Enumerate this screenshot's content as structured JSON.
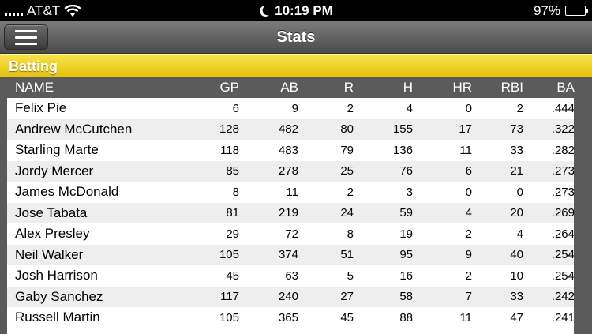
{
  "status_bar": {
    "carrier": "AT&T",
    "time": "10:19 PM",
    "battery": "97%",
    "battery_level": 0.97,
    "icons": [
      "signal-icon",
      "wifi-icon",
      "moon-icon",
      "battery-icon"
    ]
  },
  "nav": {
    "title": "Stats",
    "menu_icon": "hamburger-icon"
  },
  "section": {
    "title": "Batting"
  },
  "columns": [
    "NAME",
    "GP",
    "AB",
    "R",
    "H",
    "HR",
    "RBI",
    "BA"
  ],
  "rows": [
    {
      "name": "Felix Pie",
      "gp": "6",
      "ab": "9",
      "r": "2",
      "h": "4",
      "hr": "0",
      "rbi": "2",
      "ba": ".444"
    },
    {
      "name": "Andrew McCutchen",
      "gp": "128",
      "ab": "482",
      "r": "80",
      "h": "155",
      "hr": "17",
      "rbi": "73",
      "ba": ".322"
    },
    {
      "name": "Starling Marte",
      "gp": "118",
      "ab": "483",
      "r": "79",
      "h": "136",
      "hr": "11",
      "rbi": "33",
      "ba": ".282"
    },
    {
      "name": "Jordy Mercer",
      "gp": "85",
      "ab": "278",
      "r": "25",
      "h": "76",
      "hr": "6",
      "rbi": "21",
      "ba": ".273"
    },
    {
      "name": "James McDonald",
      "gp": "8",
      "ab": "11",
      "r": "2",
      "h": "3",
      "hr": "0",
      "rbi": "0",
      "ba": ".273"
    },
    {
      "name": "Jose Tabata",
      "gp": "81",
      "ab": "219",
      "r": "24",
      "h": "59",
      "hr": "4",
      "rbi": "20",
      "ba": ".269"
    },
    {
      "name": "Alex Presley",
      "gp": "29",
      "ab": "72",
      "r": "8",
      "h": "19",
      "hr": "2",
      "rbi": "4",
      "ba": ".264"
    },
    {
      "name": "Neil Walker",
      "gp": "105",
      "ab": "374",
      "r": "51",
      "h": "95",
      "hr": "9",
      "rbi": "40",
      "ba": ".254"
    },
    {
      "name": "Josh Harrison",
      "gp": "45",
      "ab": "63",
      "r": "5",
      "h": "16",
      "hr": "2",
      "rbi": "10",
      "ba": ".254"
    },
    {
      "name": "Gaby Sanchez",
      "gp": "117",
      "ab": "240",
      "r": "27",
      "h": "58",
      "hr": "7",
      "rbi": "33",
      "ba": ".242"
    },
    {
      "name": "Russell Martin",
      "gp": "105",
      "ab": "365",
      "r": "45",
      "h": "88",
      "hr": "11",
      "rbi": "47",
      "ba": ".241"
    }
  ],
  "colors": {
    "section_yellow": "#f2d41c",
    "nav_gray": "#5b5b5b",
    "row_alt": "#eeeeee"
  }
}
